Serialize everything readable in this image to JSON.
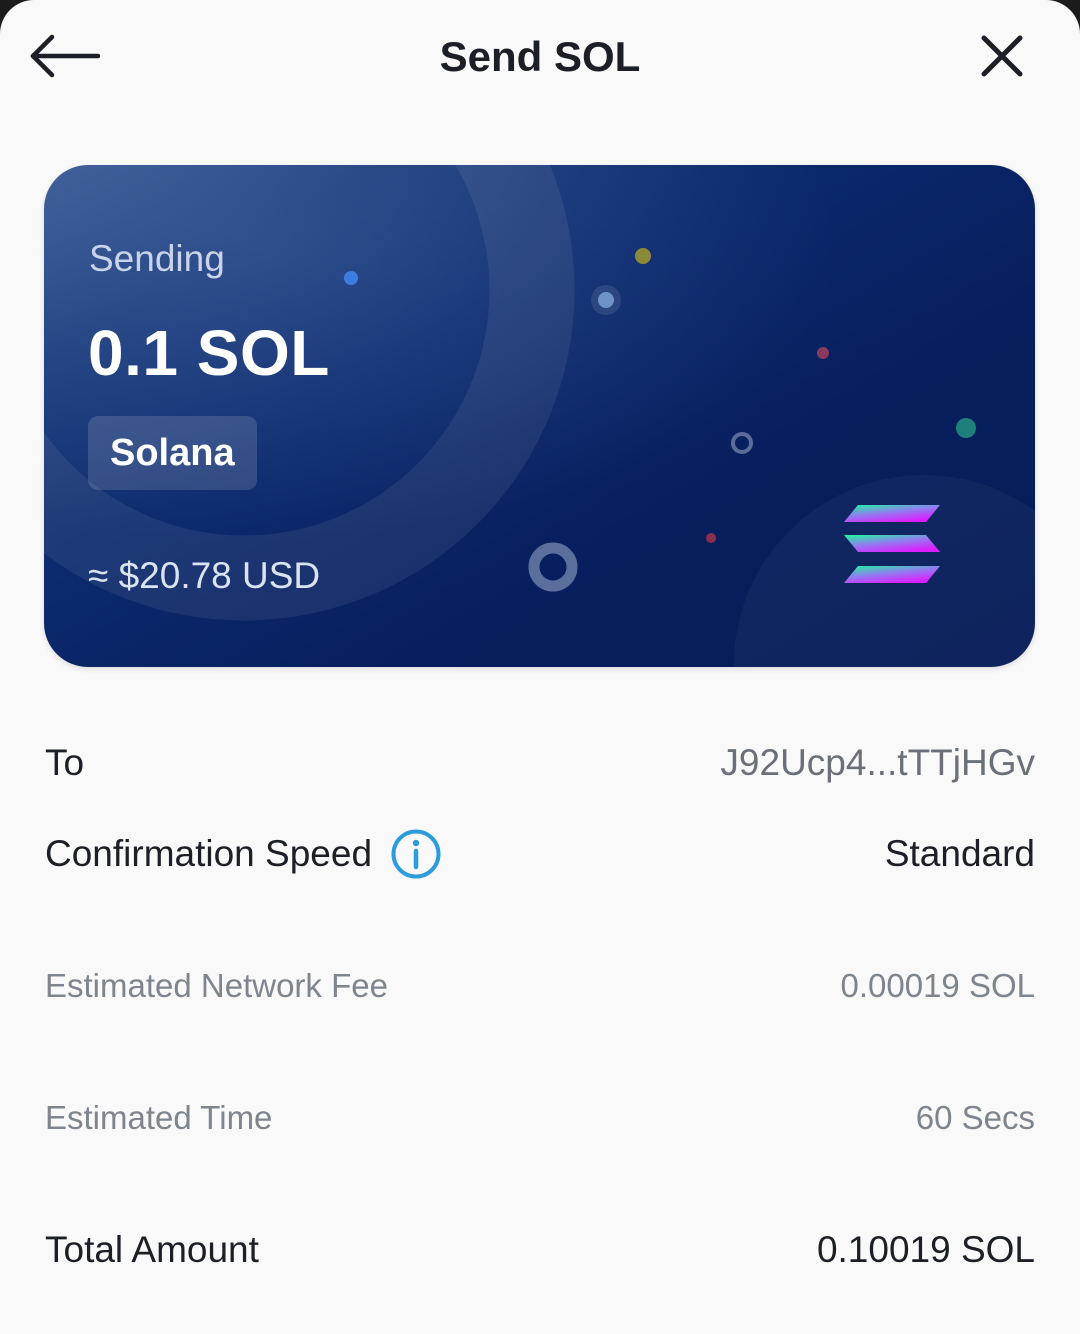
{
  "header": {
    "title": "Send SOL",
    "back_icon": "arrow-left-icon",
    "close_icon": "close-icon"
  },
  "card": {
    "sending_label": "Sending",
    "amount": "0.1 SOL",
    "network": "Solana",
    "usd_value": "≈ $20.78 USD",
    "logo_icon": "solana-logo-icon",
    "colors": {
      "background": "#071f5e",
      "logo_gradient_start": "#19fb9b",
      "logo_gradient_end": "#dc1fff"
    }
  },
  "details": {
    "to": {
      "label": "To",
      "value": "J92Ucp4...tTTjHGv"
    },
    "speed": {
      "label": "Confirmation Speed",
      "value": "Standard",
      "info_icon": "info-icon"
    },
    "fee": {
      "label": "Estimated Network Fee",
      "value": "0.00019 SOL"
    },
    "time": {
      "label": "Estimated Time",
      "value": "60 Secs"
    },
    "total": {
      "label": "Total Amount",
      "value": "0.10019 SOL"
    }
  },
  "colors": {
    "accent": "#2d9cdb",
    "text_primary": "#1c1f26",
    "text_secondary": "#7f858d"
  }
}
